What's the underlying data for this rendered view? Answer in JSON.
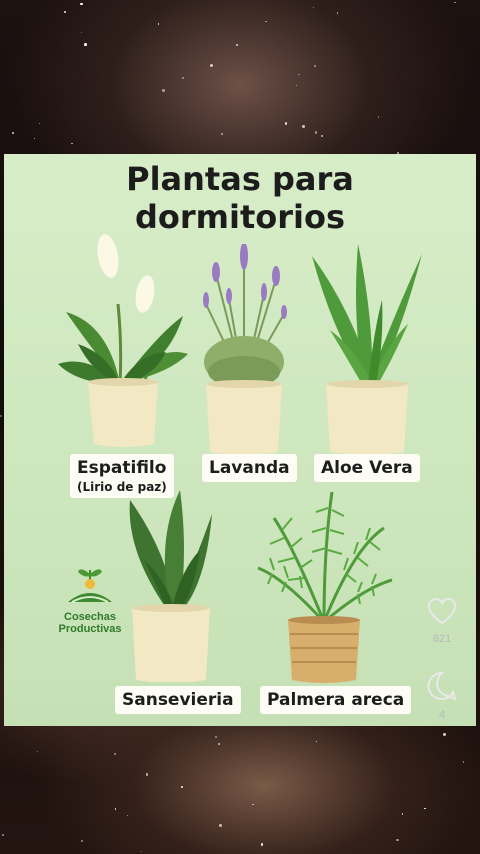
{
  "card": {
    "title_line1": "Plantas para",
    "title_line2": "dormitorios"
  },
  "plants": [
    {
      "name": "Espatifilo",
      "subtitle": "(Lirio de paz)"
    },
    {
      "name": "Lavanda"
    },
    {
      "name": "Aloe Vera"
    },
    {
      "name": "Sansevieria"
    },
    {
      "name": "Palmera areca"
    }
  ],
  "logo": {
    "line1": "Cosechas",
    "line2": "Productivas"
  },
  "actions": {
    "like_icon": "heart-icon",
    "like_count": "621",
    "comment_icon": "comment-icon",
    "comment_count": "4"
  },
  "colors": {
    "card_bg": "#d7edc8",
    "pot": "#f2e8c4",
    "leaf": "#3f7f2e",
    "label_bg": "#fdfdf6"
  }
}
